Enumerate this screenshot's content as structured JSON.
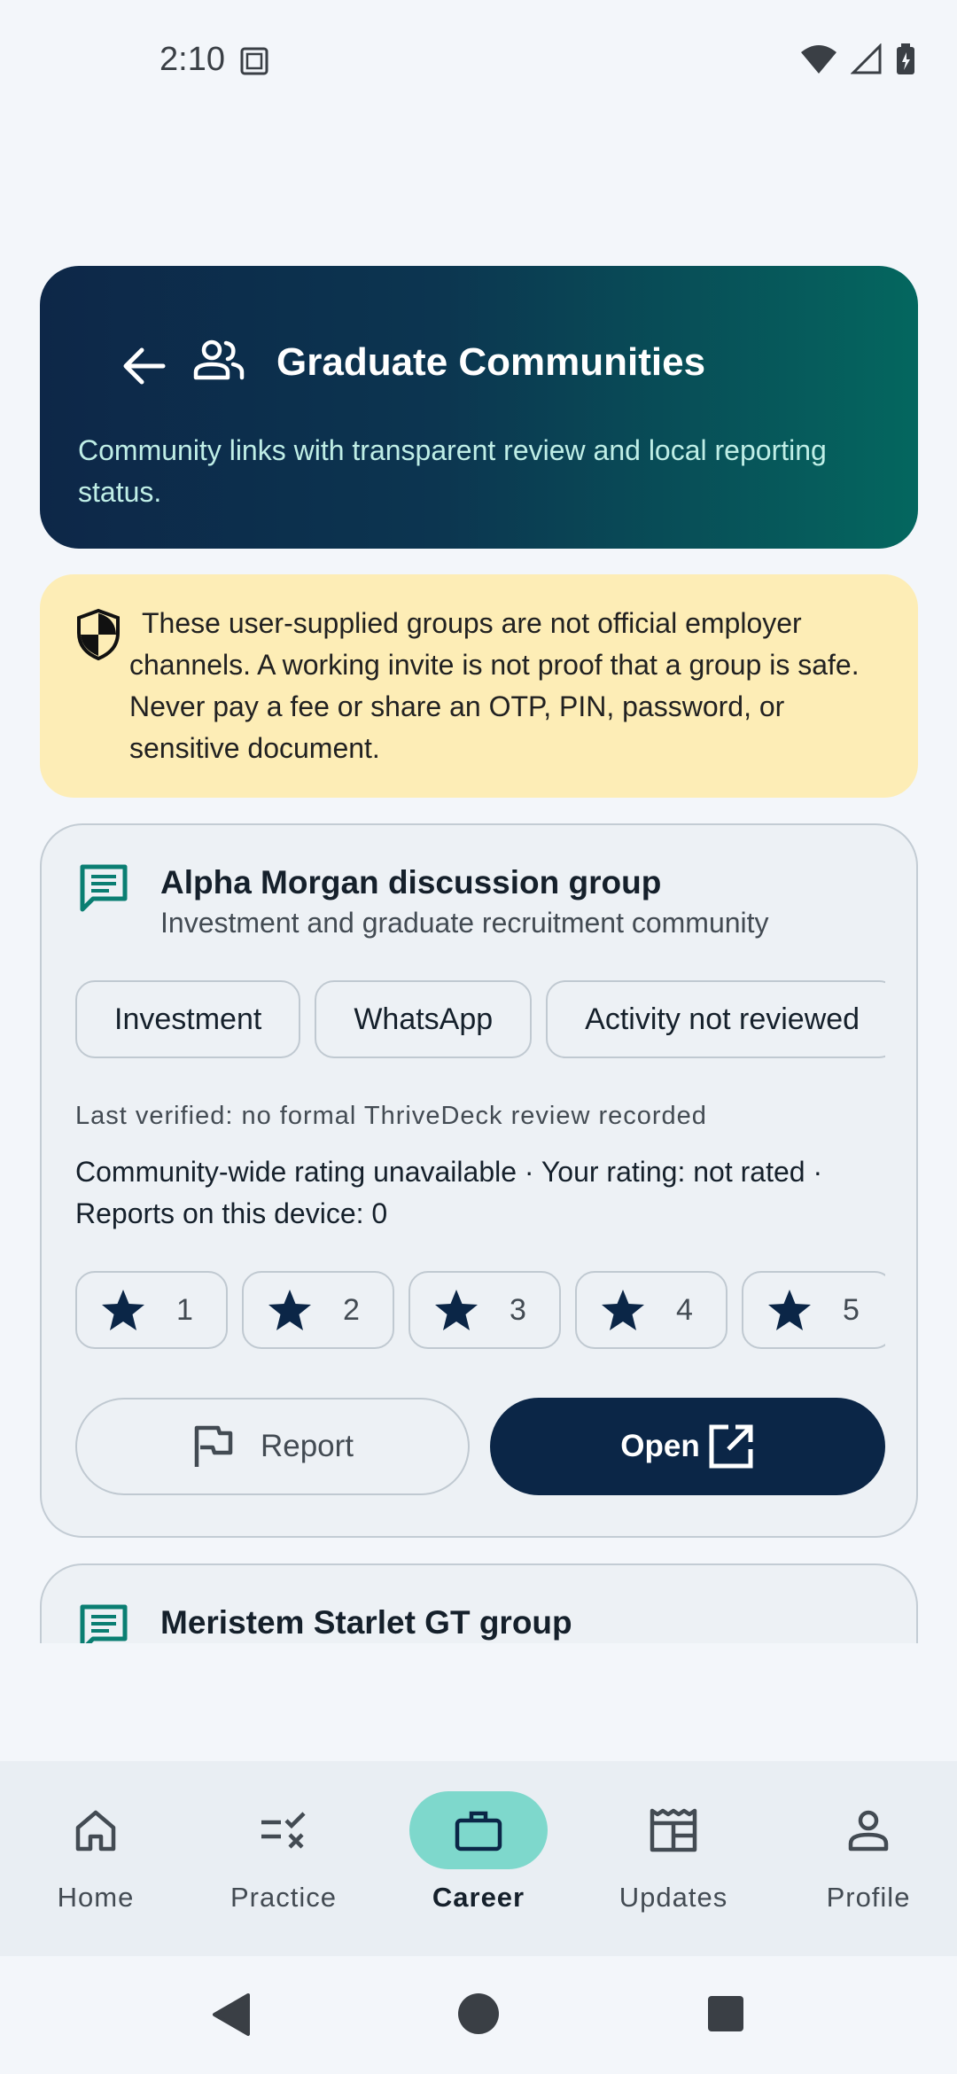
{
  "status_bar": {
    "time": "2:10"
  },
  "header": {
    "title": "Graduate Communities",
    "subtitle": "Community links with transparent review and local reporting status."
  },
  "warning": {
    "text": "These user-supplied groups are not official employer channels. A working invite is not proof that a group is safe. Never pay a fee or share an OTP, PIN, password, or sensitive document."
  },
  "communities": [
    {
      "title": "Alpha Morgan discussion group",
      "subtitle": "Investment and graduate recruitment community",
      "chips": [
        "Investment",
        "WhatsApp",
        "Activity not reviewed"
      ],
      "last_verified": "Last verified: no formal ThriveDeck review recorded",
      "rating_info": "Community-wide rating unavailable · Your rating: not rated · Reports on this device: 0",
      "ratings": [
        "1",
        "2",
        "3",
        "4",
        "5"
      ],
      "report_label": "Report",
      "open_label": "Open"
    },
    {
      "title": "Meristem Starlet GT group"
    }
  ],
  "bottom_nav": [
    {
      "label": "Home",
      "icon": "home-icon"
    },
    {
      "label": "Practice",
      "icon": "practice-icon"
    },
    {
      "label": "Career",
      "icon": "briefcase-icon",
      "active": true
    },
    {
      "label": "Updates",
      "icon": "newspaper-icon"
    },
    {
      "label": "Profile",
      "icon": "person-icon"
    }
  ],
  "colors": {
    "header_start": "#0d2748",
    "header_end": "#04675f",
    "warning_bg": "#fdedb6",
    "accent_teal": "#0a7e72",
    "primary_dark": "#0b2647",
    "nav_active": "#7ed8cc"
  }
}
